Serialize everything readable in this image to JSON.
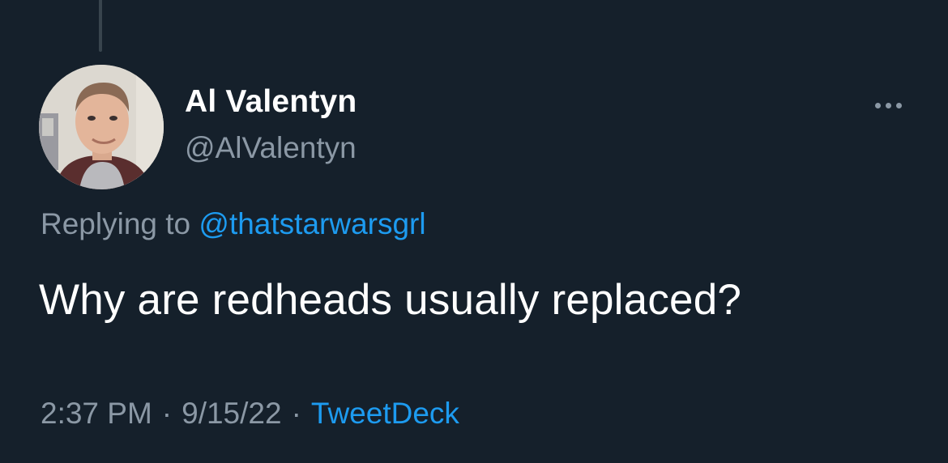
{
  "tweet": {
    "author": {
      "name": "Al Valentyn",
      "handle": "@AlValentyn"
    },
    "reply": {
      "prefix": "Replying to",
      "mention": "@thatstarwarsgrl"
    },
    "text": "Why are redheads usually replaced?",
    "meta": {
      "time": "2:37 PM",
      "separator": "·",
      "date": "9/15/22",
      "source": "TweetDeck"
    }
  },
  "colors": {
    "background": "#15202b",
    "primary_text": "#ffffff",
    "secondary_text": "#8b98a5",
    "link": "#1d9bf0",
    "thread_line": "#38444d"
  },
  "icons": {
    "more": "more-horizontal-icon"
  }
}
